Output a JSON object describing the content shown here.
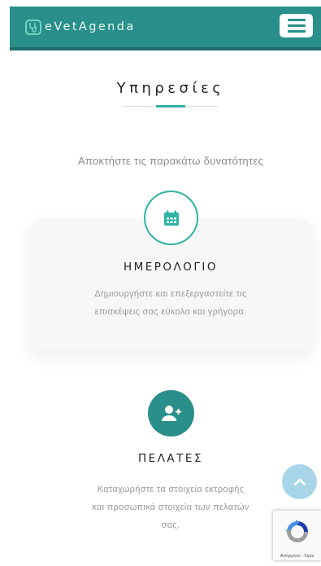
{
  "navbar": {
    "brand": "eVetAgenda",
    "menu_icon": "hamburger-menu-icon",
    "brand_icon": "stethoscope-icon",
    "bg_color": "#2a8f8a"
  },
  "section": {
    "title": "Υπηρεσίες",
    "subtitle": "Αποκτήστε τις παρακάτω δυνατότητες",
    "accent_color": "#2fb3a4"
  },
  "services": [
    {
      "icon": "calendar-icon",
      "title": "ΗΜΕΡΟΛΟΓΙΟ",
      "desc_line1": "Δημιουργήστε και επεξεργαστείτε τις",
      "desc_line2": "επισκέψεις σας εύκολα και γρήγορα."
    },
    {
      "icon": "add-user-icon",
      "title": "ΠΕΛΑΤΕΣ",
      "desc_line1": "Καταχωρήστε τα στοιχεία εκτροφής",
      "desc_line2": "και προσωπικά στοιχεία των πελατών",
      "desc_line3": "σας."
    }
  ],
  "back_to_top": {
    "icon": "chevron-up-icon"
  },
  "recaptcha": {
    "links": "Απόρρητο - Όροι",
    "icon": "recaptcha-icon"
  }
}
